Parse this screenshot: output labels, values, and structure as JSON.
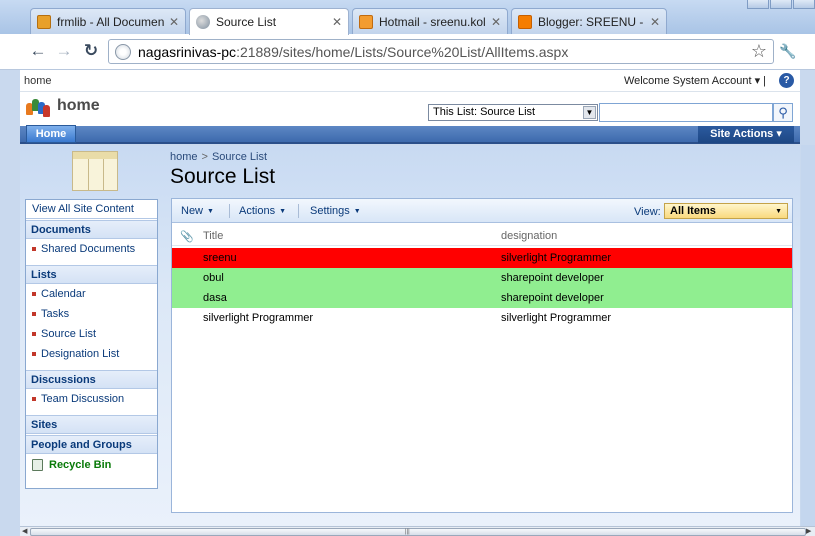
{
  "browser": {
    "tabs": [
      {
        "title": "frmlib - All Documen",
        "favicon": "frmlib-icon",
        "active": false
      },
      {
        "title": "Source List",
        "favicon": "sharepoint-page-icon",
        "active": true
      },
      {
        "title": "Hotmail - sreenu.kol",
        "favicon": "hotmail-icon",
        "active": false
      },
      {
        "title": "Blogger: SREENU - C",
        "favicon": "blogger-icon",
        "active": false
      }
    ],
    "url_host": "nagasrinivas-pc",
    "url_rest": ":21889/sites/home/Lists/Source%20List/AllItems.aspx",
    "icons": {
      "back": "←",
      "forward": "→",
      "reload": "↻",
      "star": "☆",
      "wrench": "🔧",
      "close": "✕"
    }
  },
  "sharepoint": {
    "top_link": "home",
    "welcome": "Welcome System Account ▾ |",
    "help": "?",
    "site_title": "home",
    "search_scope": "This List: Source List",
    "search_placeholder": "",
    "nav": {
      "home_tab": "Home",
      "site_actions": "Site Actions ▾"
    },
    "breadcrumb": [
      "home",
      "Source List"
    ],
    "breadcrumb_sep": ">",
    "page_title": "Source List",
    "quick_launch": {
      "view_all": "View All Site Content",
      "sections": [
        {
          "heading": "Documents",
          "items": [
            "Shared Documents"
          ]
        },
        {
          "heading": "Lists",
          "items": [
            "Calendar",
            "Tasks",
            "Source List",
            "Designation List"
          ]
        },
        {
          "heading": "Discussions",
          "items": [
            "Team Discussion"
          ]
        },
        {
          "heading": "Sites",
          "items": []
        },
        {
          "heading": "People and Groups",
          "items": []
        }
      ],
      "recycle_bin": "Recycle Bin"
    },
    "list_toolbar": {
      "new": "New",
      "actions": "Actions",
      "settings": "Settings",
      "view_label": "View:",
      "view_value": "All Items"
    },
    "list": {
      "columns": [
        "Title",
        "designation"
      ],
      "rows": [
        {
          "title": "sreenu",
          "designation": "silverlight Programmer",
          "color": "#ff0000"
        },
        {
          "title": "obul",
          "designation": "sharepoint developer",
          "color": "#90ee90"
        },
        {
          "title": "dasa",
          "designation": "sharepoint developer",
          "color": "#90ee90"
        },
        {
          "title": "silverlight Programmer",
          "designation": "silverlight Programmer",
          "color": "#ffffff"
        }
      ]
    }
  }
}
